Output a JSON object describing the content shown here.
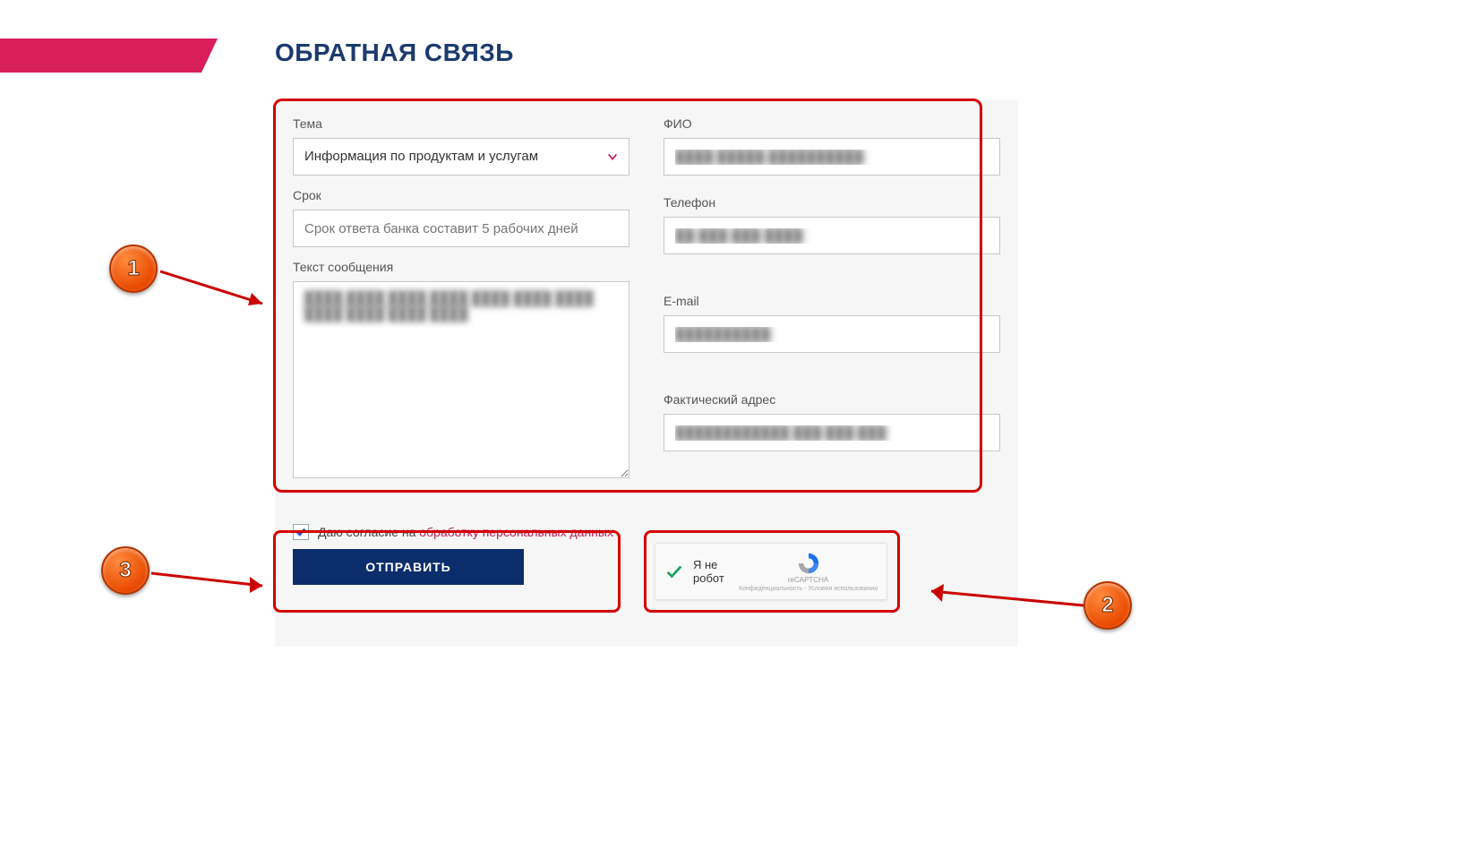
{
  "page": {
    "title": "ОБРАТНАЯ СВЯЗЬ"
  },
  "form": {
    "topic": {
      "label": "Тема",
      "value": "Информация по продуктам и услугам"
    },
    "term": {
      "label": "Срок",
      "placeholder": "Срок ответа банка составит 5 рабочих дней"
    },
    "message": {
      "label": "Текст сообщения",
      "value": "████ ████ ████ ████ ████ ████ ████ ████ ████ ████ ████"
    },
    "fio": {
      "label": "ФИО",
      "value": "████ █████ ██████████"
    },
    "phone": {
      "label": "Телефон",
      "value": "██-███-███-████"
    },
    "email": {
      "label": "E-mail",
      "value": "██████████"
    },
    "address": {
      "label": "Фактический адрес",
      "value": "████████████ ███ ███ ███"
    },
    "consent": {
      "prefix": "Даю согласие на ",
      "link": "обработку персональных данных"
    },
    "submit": "ОТПРАВИТЬ"
  },
  "captcha": {
    "label": "Я не робот",
    "brand": "reCAPTCHA",
    "sub": "Конфиденциальность - Условия использования"
  },
  "annotations": {
    "b1": "1",
    "b2": "2",
    "b3": "3"
  }
}
